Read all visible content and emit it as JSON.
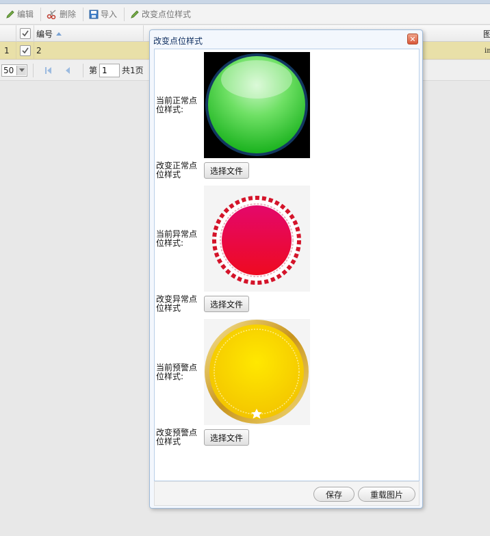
{
  "toolbar": {
    "edit_label": "编辑",
    "delete_label": "删除",
    "import_label": "导入",
    "change_style_label": "改变点位样式"
  },
  "grid": {
    "columns": [
      "编号",
      "图"
    ],
    "rows": [
      {
        "rownum": "1",
        "id": "2",
        "extra": "im"
      }
    ]
  },
  "pager": {
    "page_size": "50",
    "page_prefix": "第",
    "page_value": "1",
    "page_total": "共1页"
  },
  "dialog": {
    "title": "改变点位样式",
    "close_glyph": "✕",
    "rows": {
      "normal_current_label": "当前正常点位样式:",
      "normal_change_label": "改变正常点位样式",
      "abnormal_current_label": "当前异常点位样式:",
      "abnormal_change_label": "改变异常点位样式",
      "warning_current_label": "当前预警点位样式:",
      "warning_change_label": "改变预警点位样式"
    },
    "choose_file_label": "选择文件",
    "save_label": "保存",
    "reload_label": "重载图片"
  },
  "colors": {
    "normal": "#2fc63a",
    "abnormal": "#e3073e",
    "warning": "#fcd800",
    "selected_row": "#e9e0a8"
  }
}
